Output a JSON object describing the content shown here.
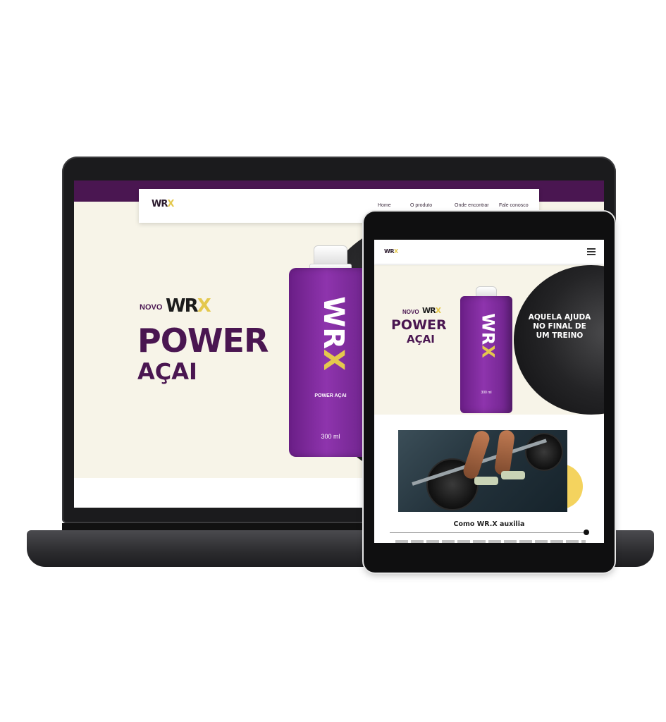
{
  "desktop": {
    "logo": {
      "text": "WR",
      "x": "X"
    },
    "nav": [
      "Home",
      "O produto",
      "Onde encontrar",
      "Fale conosco"
    ],
    "hero": {
      "novo": "NOVO",
      "brand": "WR",
      "brand_x": "X",
      "title": "POWER",
      "subtitle": "AÇAI"
    },
    "carton": {
      "logo": "WR",
      "logo_x": "X",
      "name": "POWER AÇAI",
      "volume": "300 ml"
    }
  },
  "tablet": {
    "logo": {
      "text": "WR",
      "x": "X"
    },
    "hero": {
      "novo": "NOVO",
      "brand": "WR",
      "brand_x": "X",
      "title": "POWER",
      "subtitle": "AÇAI",
      "tagline": "AQUELA AJUDA NO FINAL DE UM TREINO"
    },
    "carton": {
      "logo": "WR",
      "logo_x": "X",
      "volume": "300 ml"
    },
    "section_title": "Como WR.X auxilia"
  },
  "colors": {
    "brand_purple": "#4a1651",
    "accent_yellow": "#e4c84d",
    "cream_bg": "#f7f4e8"
  },
  "icons": [
    "hamburger-menu-icon"
  ]
}
